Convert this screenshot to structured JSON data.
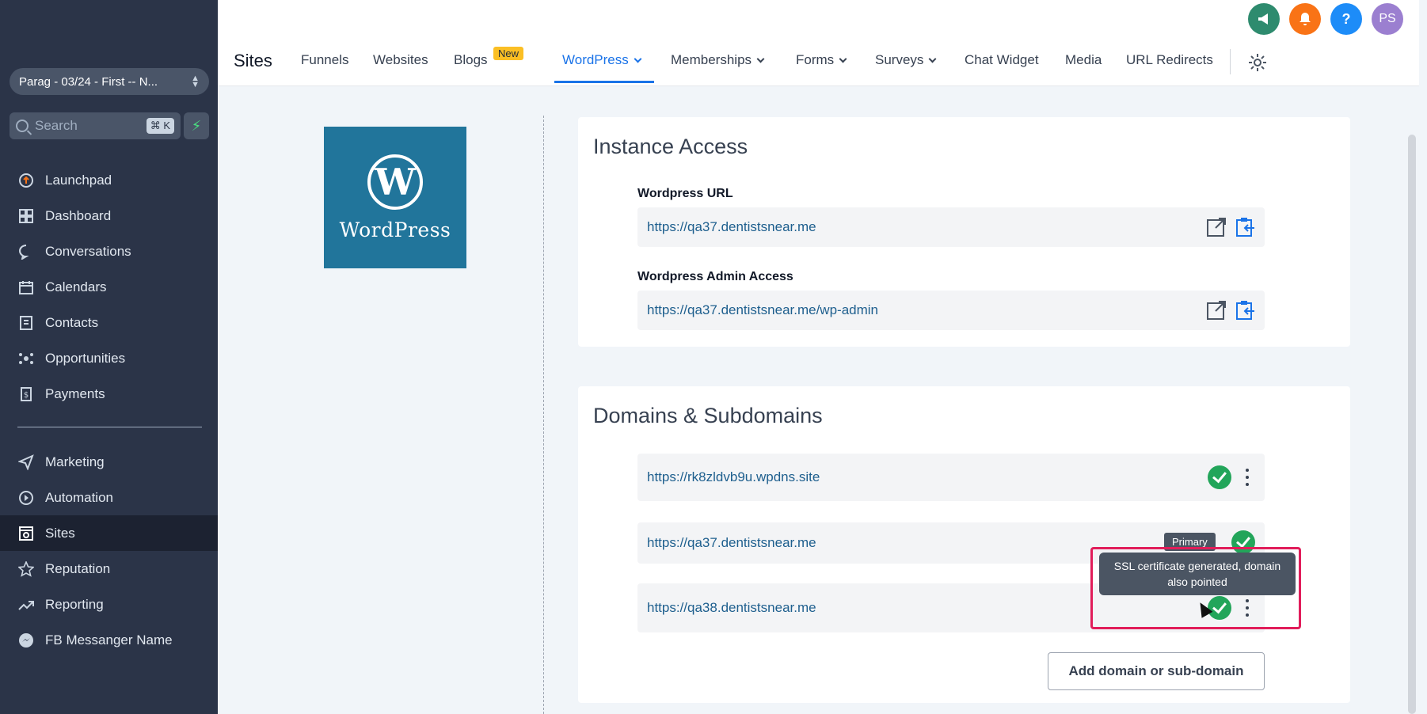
{
  "sidebar": {
    "account": "Parag - 03/24 - First -- N...",
    "search_placeholder": "Search",
    "shortcut": "⌘ K",
    "items": [
      {
        "label": "Launchpad",
        "icon": "launchpad-icon"
      },
      {
        "label": "Dashboard",
        "icon": "dashboard-icon"
      },
      {
        "label": "Conversations",
        "icon": "chat-icon"
      },
      {
        "label": "Calendars",
        "icon": "calendar-icon"
      },
      {
        "label": "Contacts",
        "icon": "contacts-icon"
      },
      {
        "label": "Opportunities",
        "icon": "opportunities-icon"
      },
      {
        "label": "Payments",
        "icon": "payments-icon"
      }
    ],
    "items2": [
      {
        "label": "Marketing",
        "icon": "send-icon"
      },
      {
        "label": "Automation",
        "icon": "automation-icon"
      },
      {
        "label": "Sites",
        "icon": "sites-icon",
        "active": true
      },
      {
        "label": "Reputation",
        "icon": "star-icon"
      },
      {
        "label": "Reporting",
        "icon": "trend-icon"
      },
      {
        "label": "FB Messanger Name",
        "icon": "messenger-icon"
      }
    ]
  },
  "header": {
    "title": "Sites",
    "tabs": [
      "Funnels",
      "Websites",
      "Blogs",
      "WordPress",
      "Memberships",
      "Forms",
      "Surveys",
      "Chat Widget",
      "Media",
      "URL Redirects"
    ],
    "new_badge": "New",
    "avatar": "PS",
    "help": "?"
  },
  "logo_text": "WordPress",
  "instance_access": {
    "title": "Instance Access",
    "url_label": "Wordpress URL",
    "url": "https://qa37.dentistsnear.me",
    "admin_label": "Wordpress Admin Access",
    "admin_url": "https://qa37.dentistsnear.me/wp-admin"
  },
  "domains": {
    "title": "Domains & Subdomains",
    "items": [
      "https://rk8zldvb9u.wpdns.site",
      "https://qa37.dentistsnear.me",
      "https://qa38.dentistsnear.me"
    ],
    "primary_badge": "Primary",
    "tooltip": "SSL certificate generated, domain also pointed",
    "add_button": "Add domain or sub-domain"
  },
  "colors": {
    "accent": "#1a73e8",
    "success": "#22a55a",
    "wordpress": "#21759b",
    "highlight": "#e11d5a"
  }
}
